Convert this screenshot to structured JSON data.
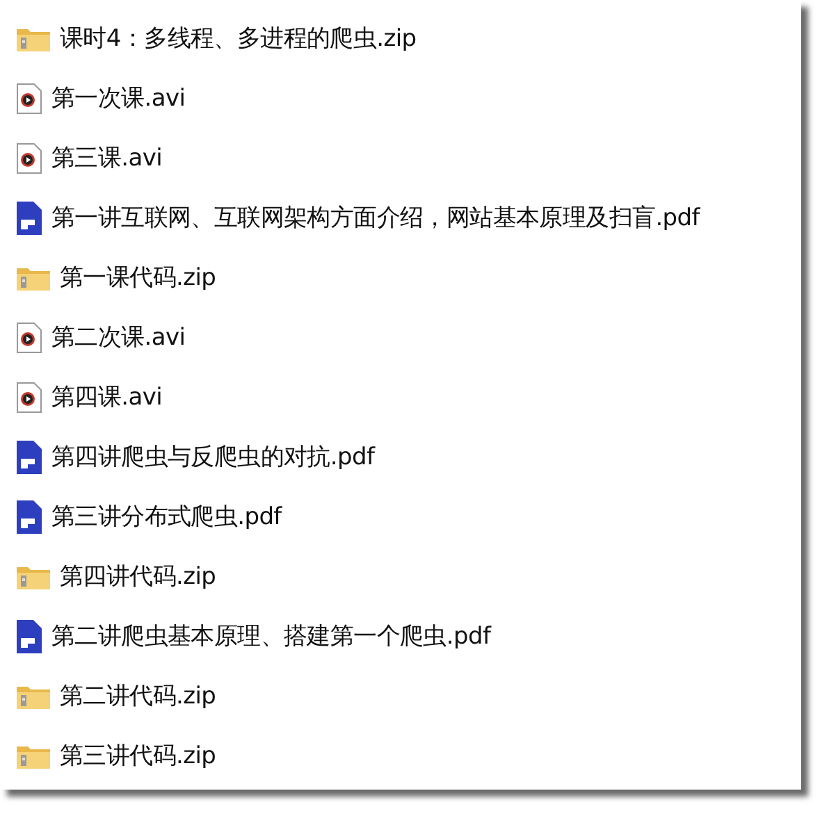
{
  "files": [
    {
      "kind": "zip",
      "name": "课时4：多线程、多进程的爬虫.zip"
    },
    {
      "kind": "video",
      "name": "第一次课.avi"
    },
    {
      "kind": "video",
      "name": "第三课.avi"
    },
    {
      "kind": "pdf",
      "name": "第一讲互联网、互联网架构方面介绍，网站基本原理及扫盲.pdf"
    },
    {
      "kind": "zip",
      "name": "第一课代码.zip"
    },
    {
      "kind": "video",
      "name": "第二次课.avi"
    },
    {
      "kind": "video",
      "name": "第四课.avi"
    },
    {
      "kind": "pdf",
      "name": "第四讲爬虫与反爬虫的对抗.pdf"
    },
    {
      "kind": "pdf",
      "name": "第三讲分布式爬虫.pdf"
    },
    {
      "kind": "zip",
      "name": "第四讲代码.zip"
    },
    {
      "kind": "pdf",
      "name": "第二讲爬虫基本原理、搭建第一个爬虫.pdf"
    },
    {
      "kind": "zip",
      "name": "第二讲代码.zip"
    },
    {
      "kind": "zip",
      "name": "第三讲代码.zip"
    }
  ]
}
